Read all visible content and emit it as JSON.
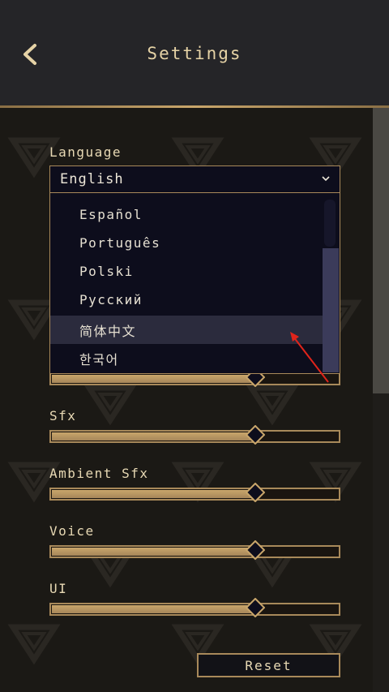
{
  "header": {
    "title": "Settings",
    "back_icon": "chevron-left-icon"
  },
  "language": {
    "label": "Language",
    "selected": "English",
    "chevron_icon": "chevron-down-icon",
    "options": [
      {
        "label": "Español",
        "highlighted": false
      },
      {
        "label": "Português",
        "highlighted": false
      },
      {
        "label": "Polski",
        "highlighted": false
      },
      {
        "label": "Русский",
        "highlighted": false
      },
      {
        "label": "简体中文",
        "highlighted": true
      },
      {
        "label": "한국어",
        "highlighted": false
      }
    ]
  },
  "sliders": [
    {
      "label": "",
      "value": 0.71
    },
    {
      "label": "Sfx",
      "value": 0.71
    },
    {
      "label": "Ambient Sfx",
      "value": 0.71
    },
    {
      "label": "Voice",
      "value": 0.71
    },
    {
      "label": "UI",
      "value": 0.71
    }
  ],
  "reset": {
    "label": "Reset"
  },
  "colors": {
    "accent_gold": "#a8895a",
    "slider_fill": "#c9a66b",
    "dropdown_bg": "#0d0d1c",
    "highlight_bg": "#2b2b3d",
    "annotation_arrow": "#e0241b"
  }
}
